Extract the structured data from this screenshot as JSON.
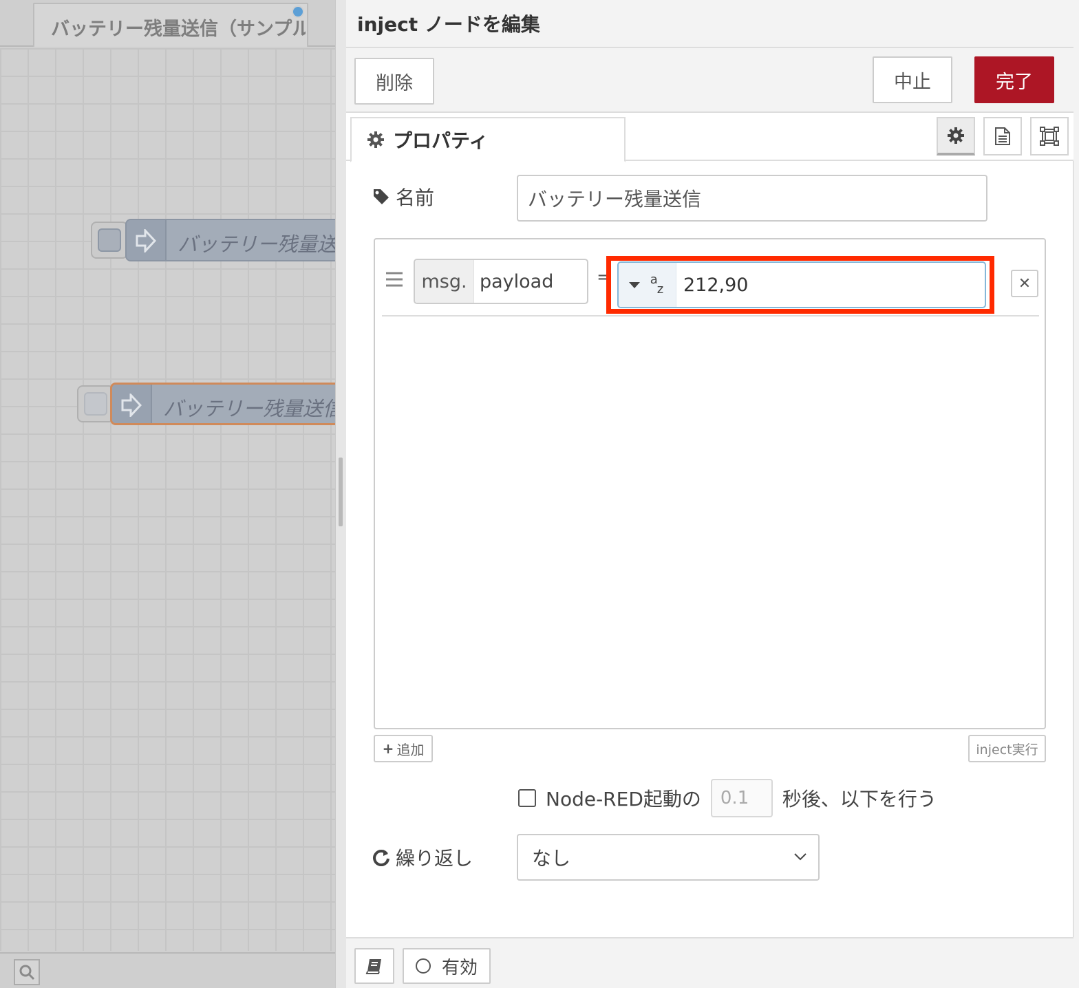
{
  "workspace": {
    "flow_tab_label": "バッテリー残量送信（サンプル",
    "nodes": [
      {
        "label": "バッテリー残量送信"
      },
      {
        "label": "バッテリー残量送信"
      }
    ]
  },
  "tray": {
    "title": "inject ノードを編集",
    "toolbar": {
      "delete_label": "削除",
      "cancel_label": "中止",
      "done_label": "完了"
    },
    "tabs": {
      "properties_label": "プロパティ"
    },
    "name": {
      "label": "名前",
      "value": "バッテリー残量送信"
    },
    "property": {
      "prefix": "msg.",
      "name": "payload",
      "equals": "=",
      "type_icon": "string-az-icon",
      "value": "212,90"
    },
    "add_label": "追加",
    "inject_now_label": "inject実行",
    "once": {
      "label_before": "Node-RED起動の",
      "delay": "0.1",
      "label_after": "秒後、以下を行う",
      "checked": false
    },
    "repeat": {
      "label": "繰り返し",
      "value": "なし"
    },
    "footer": {
      "enable_label": "有効"
    }
  },
  "colors": {
    "done_button": "#ad1625",
    "highlight": "#ff2a00",
    "node": "#a3acb8",
    "selected_node_border": "#d08a5a"
  }
}
